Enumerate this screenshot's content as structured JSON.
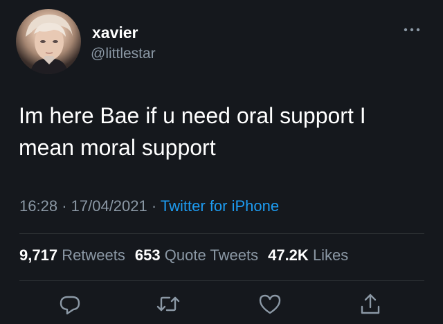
{
  "user": {
    "display_name": "xavier",
    "handle": "@littlestar"
  },
  "tweet": {
    "text": "Im here Bae if u need oral support I mean moral support",
    "time": "16:28",
    "separator": "·",
    "date": "17/04/2021",
    "source": "Twitter for iPhone"
  },
  "stats": {
    "retweets_count": "9,717",
    "retweets_label": "Retweets",
    "quote_count": "653",
    "quote_label": "Quote Tweets",
    "likes_count": "47.2K",
    "likes_label": "Likes"
  },
  "actions": {
    "reply_icon": "reply-icon",
    "retweet_icon": "retweet-icon",
    "like_icon": "heart-icon",
    "share_icon": "share-icon"
  },
  "colors": {
    "background": "#15181d",
    "text_primary": "#ffffff",
    "text_secondary": "#8b98a5",
    "link": "#1d9bf0",
    "divider": "#2f3336"
  }
}
